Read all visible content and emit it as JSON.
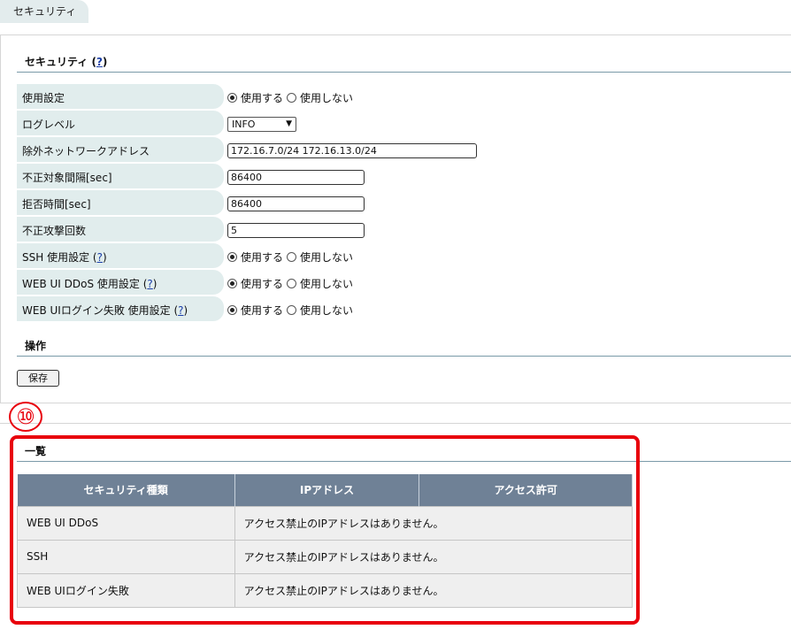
{
  "tab": {
    "label": "セキュリティ"
  },
  "security_section": {
    "title": "セキュリティ (",
    "help": "?",
    "close": ")"
  },
  "settings": [
    {
      "label": "使用設定",
      "type": "radio",
      "options": [
        "使用する",
        "使用しない"
      ],
      "selected": 0
    },
    {
      "label": "ログレベル",
      "type": "select",
      "value": "INFO"
    },
    {
      "label": "除外ネットワークアドレス",
      "type": "text",
      "value": "172.16.7.0/24 172.16.13.0/24"
    },
    {
      "label": "不正対象間隔[sec]",
      "type": "text",
      "value": "86400"
    },
    {
      "label": "拒否時間[sec]",
      "type": "text",
      "value": "86400"
    },
    {
      "label": "不正攻撃回数",
      "type": "text",
      "value": "5"
    },
    {
      "label": "SSH 使用設定 (",
      "help": "?",
      "close": ")",
      "type": "radio",
      "options": [
        "使用する",
        "使用しない"
      ],
      "selected": 0
    },
    {
      "label": "WEB UI DDoS 使用設定 (",
      "help": "?",
      "close": ")",
      "type": "radio",
      "options": [
        "使用する",
        "使用しない"
      ],
      "selected": 0
    },
    {
      "label": "WEB UIログイン失敗 使用設定 (",
      "help": "?",
      "close": ")",
      "type": "radio",
      "options": [
        "使用する",
        "使用しない"
      ],
      "selected": 0
    }
  ],
  "operation_section": {
    "title": "操作",
    "save_label": "保存"
  },
  "marker": {
    "label": "⑩"
  },
  "list_section": {
    "title": "一覧",
    "columns": [
      "セキュリティ種類",
      "IPアドレス",
      "アクセス許可"
    ],
    "rows": [
      {
        "type": "WEB UI DDoS",
        "message": "アクセス禁止のIPアドレスはありません。"
      },
      {
        "type": "SSH",
        "message": "アクセス禁止のIPアドレスはありません。"
      },
      {
        "type": "WEB UIログイン失敗",
        "message": "アクセス禁止のIPアドレスはありません。"
      }
    ]
  },
  "colors": {
    "accent_red": "#e8000c",
    "table_header": "#6f8196",
    "label_bg": "#e1eded"
  }
}
